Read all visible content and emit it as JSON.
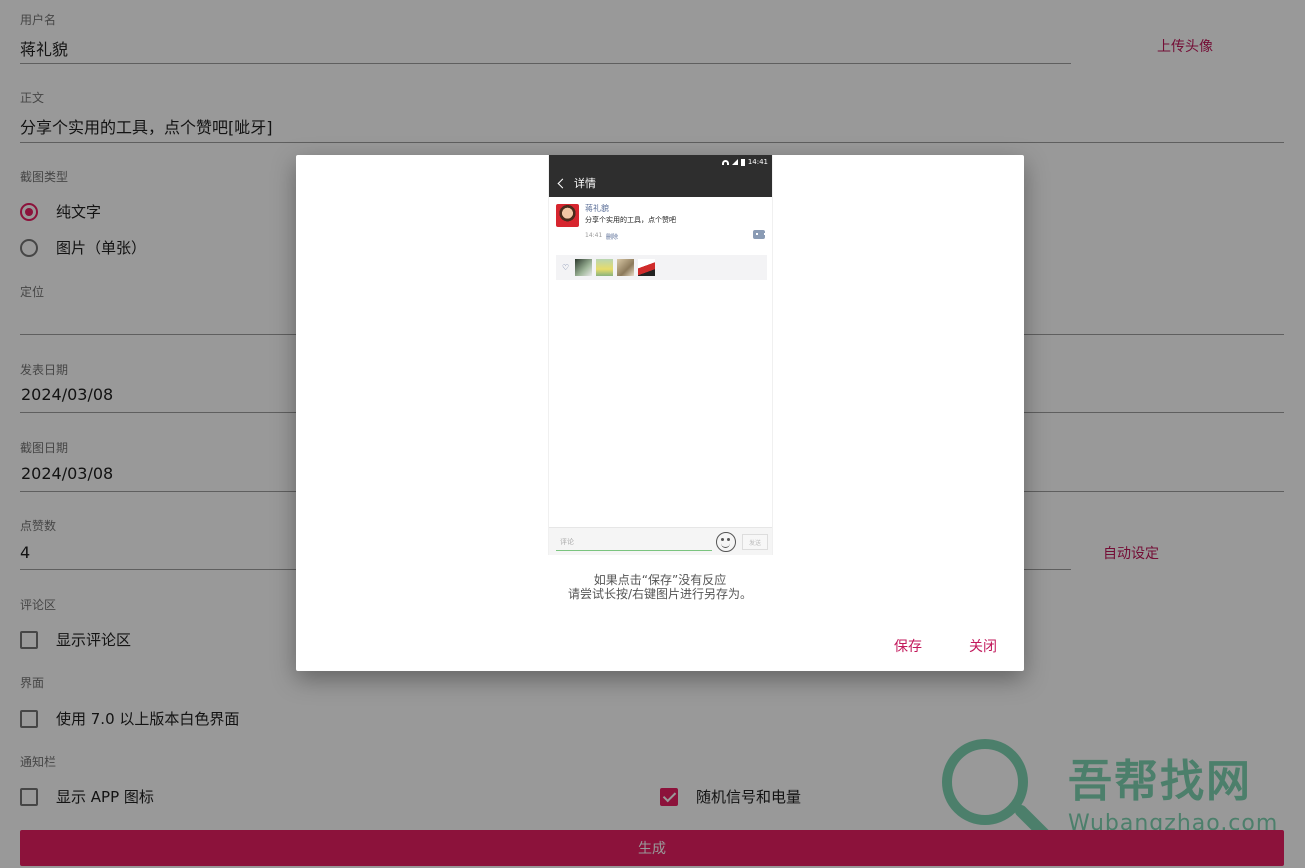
{
  "form": {
    "username": {
      "label": "用户名",
      "value": "蒋礼貌"
    },
    "upload_avatar": "上传头像",
    "body": {
      "label": "正文",
      "value": "分享个实用的工具，点个赞吧[呲牙]"
    },
    "screenshot_type": {
      "label": "截图类型",
      "options": [
        "纯文字",
        "图片（单张）"
      ],
      "selected": "纯文字"
    },
    "location": {
      "label": "定位",
      "value": ""
    },
    "post_date": {
      "label": "发表日期",
      "value": "2024/03/08"
    },
    "shot_date": {
      "label": "截图日期",
      "value": "2024/03/08"
    },
    "likes": {
      "label": "点赞数",
      "value": "4"
    },
    "auto_set": "自动设定",
    "comments": {
      "label": "评论区",
      "checkbox": "显示评论区",
      "checked": false
    },
    "interface": {
      "label": "界面",
      "checkbox": "使用 7.0 以上版本白色界面",
      "checked": false
    },
    "notification": {
      "label": "通知栏",
      "show_app_icon": {
        "label": "显示 APP 图标",
        "checked": false
      },
      "random_signal": {
        "label": "随机信号和电量",
        "checked": true
      }
    },
    "generate_button": "生成"
  },
  "dialog": {
    "preview": {
      "status_time": "14:41",
      "title": "详情",
      "post_name": "蒋礼貌",
      "post_text": "分享个实用的工具，点个赞吧",
      "post_time": "14:41",
      "delete_label": "删除",
      "like_avatars": [
        "like-avatar-1",
        "like-avatar-2",
        "like-avatar-3",
        "like-avatar-4"
      ],
      "comment_placeholder": "评论",
      "send_label": "发送"
    },
    "tip_line1": "如果点击“保存”没有反应",
    "tip_line2": "请尝试长按/右键图片进行另存为。",
    "save_button": "保存",
    "close_button": "关闭"
  },
  "watermark": {
    "text": "吾帮找网",
    "url": "Wubangzhao.com"
  },
  "colors": {
    "accent": "#e91e63",
    "link": "#c2185b",
    "wechat_blue": "#576b95"
  }
}
